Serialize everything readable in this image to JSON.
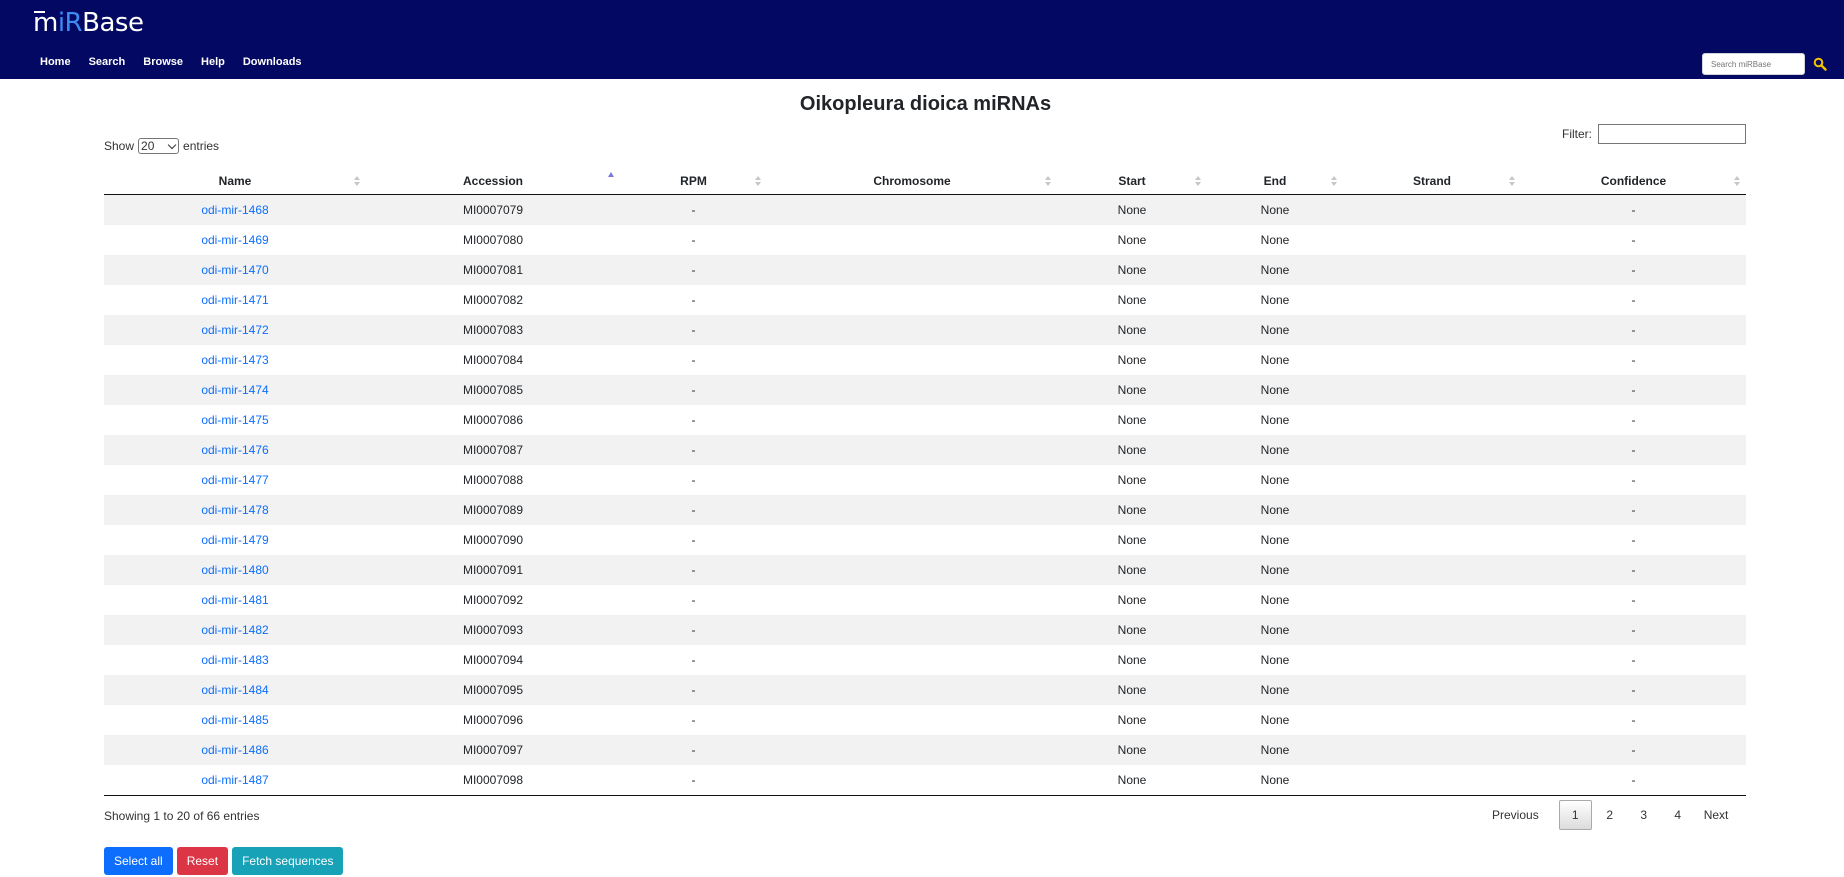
{
  "header": {
    "logo": {
      "m": "m",
      "ir": "iR",
      "base": "Base"
    },
    "nav": [
      "Home",
      "Search",
      "Browse",
      "Help",
      "Downloads"
    ],
    "search_placeholder": "Search miRBase"
  },
  "page": {
    "title": "Oikopleura dioica miRNAs",
    "show_label": "Show",
    "entries_label": "entries",
    "page_size": "20",
    "filter_label": "Filter:"
  },
  "table": {
    "columns": [
      "Name",
      "Accession",
      "RPM",
      "Chromosome",
      "Start",
      "End",
      "Strand",
      "Confidence"
    ],
    "sorted_column": "Accession",
    "rows": [
      {
        "name": "odi-mir-1468",
        "accession": "MI0007079",
        "rpm": "-",
        "chromosome": "",
        "start": "None",
        "end": "None",
        "strand": "",
        "confidence": "-"
      },
      {
        "name": "odi-mir-1469",
        "accession": "MI0007080",
        "rpm": "-",
        "chromosome": "",
        "start": "None",
        "end": "None",
        "strand": "",
        "confidence": "-"
      },
      {
        "name": "odi-mir-1470",
        "accession": "MI0007081",
        "rpm": "-",
        "chromosome": "",
        "start": "None",
        "end": "None",
        "strand": "",
        "confidence": "-"
      },
      {
        "name": "odi-mir-1471",
        "accession": "MI0007082",
        "rpm": "-",
        "chromosome": "",
        "start": "None",
        "end": "None",
        "strand": "",
        "confidence": "-"
      },
      {
        "name": "odi-mir-1472",
        "accession": "MI0007083",
        "rpm": "-",
        "chromosome": "",
        "start": "None",
        "end": "None",
        "strand": "",
        "confidence": "-"
      },
      {
        "name": "odi-mir-1473",
        "accession": "MI0007084",
        "rpm": "-",
        "chromosome": "",
        "start": "None",
        "end": "None",
        "strand": "",
        "confidence": "-"
      },
      {
        "name": "odi-mir-1474",
        "accession": "MI0007085",
        "rpm": "-",
        "chromosome": "",
        "start": "None",
        "end": "None",
        "strand": "",
        "confidence": "-"
      },
      {
        "name": "odi-mir-1475",
        "accession": "MI0007086",
        "rpm": "-",
        "chromosome": "",
        "start": "None",
        "end": "None",
        "strand": "",
        "confidence": "-"
      },
      {
        "name": "odi-mir-1476",
        "accession": "MI0007087",
        "rpm": "-",
        "chromosome": "",
        "start": "None",
        "end": "None",
        "strand": "",
        "confidence": "-"
      },
      {
        "name": "odi-mir-1477",
        "accession": "MI0007088",
        "rpm": "-",
        "chromosome": "",
        "start": "None",
        "end": "None",
        "strand": "",
        "confidence": "-"
      },
      {
        "name": "odi-mir-1478",
        "accession": "MI0007089",
        "rpm": "-",
        "chromosome": "",
        "start": "None",
        "end": "None",
        "strand": "",
        "confidence": "-"
      },
      {
        "name": "odi-mir-1479",
        "accession": "MI0007090",
        "rpm": "-",
        "chromosome": "",
        "start": "None",
        "end": "None",
        "strand": "",
        "confidence": "-"
      },
      {
        "name": "odi-mir-1480",
        "accession": "MI0007091",
        "rpm": "-",
        "chromosome": "",
        "start": "None",
        "end": "None",
        "strand": "",
        "confidence": "-"
      },
      {
        "name": "odi-mir-1481",
        "accession": "MI0007092",
        "rpm": "-",
        "chromosome": "",
        "start": "None",
        "end": "None",
        "strand": "",
        "confidence": "-"
      },
      {
        "name": "odi-mir-1482",
        "accession": "MI0007093",
        "rpm": "-",
        "chromosome": "",
        "start": "None",
        "end": "None",
        "strand": "",
        "confidence": "-"
      },
      {
        "name": "odi-mir-1483",
        "accession": "MI0007094",
        "rpm": "-",
        "chromosome": "",
        "start": "None",
        "end": "None",
        "strand": "",
        "confidence": "-"
      },
      {
        "name": "odi-mir-1484",
        "accession": "MI0007095",
        "rpm": "-",
        "chromosome": "",
        "start": "None",
        "end": "None",
        "strand": "",
        "confidence": "-"
      },
      {
        "name": "odi-mir-1485",
        "accession": "MI0007096",
        "rpm": "-",
        "chromosome": "",
        "start": "None",
        "end": "None",
        "strand": "",
        "confidence": "-"
      },
      {
        "name": "odi-mir-1486",
        "accession": "MI0007097",
        "rpm": "-",
        "chromosome": "",
        "start": "None",
        "end": "None",
        "strand": "",
        "confidence": "-"
      },
      {
        "name": "odi-mir-1487",
        "accession": "MI0007098",
        "rpm": "-",
        "chromosome": "",
        "start": "None",
        "end": "None",
        "strand": "",
        "confidence": "-"
      }
    ]
  },
  "footer": {
    "info": "Showing 1 to 20 of 66 entries",
    "pager": {
      "previous": "Previous",
      "pages": [
        "1",
        "2",
        "3",
        "4"
      ],
      "current": "1",
      "next": "Next"
    },
    "buttons": {
      "select_all": "Select all",
      "reset": "Reset",
      "fetch": "Fetch sequences"
    }
  },
  "colors": {
    "header_bg": "#030862",
    "link": "#0d6efd",
    "select_all": "#0d6efd",
    "reset": "#dc3545",
    "fetch": "#17a2b8"
  },
  "icons": {
    "search": "search-icon",
    "sort": "sort-both-icon",
    "sort_asc": "sort-asc-icon"
  }
}
